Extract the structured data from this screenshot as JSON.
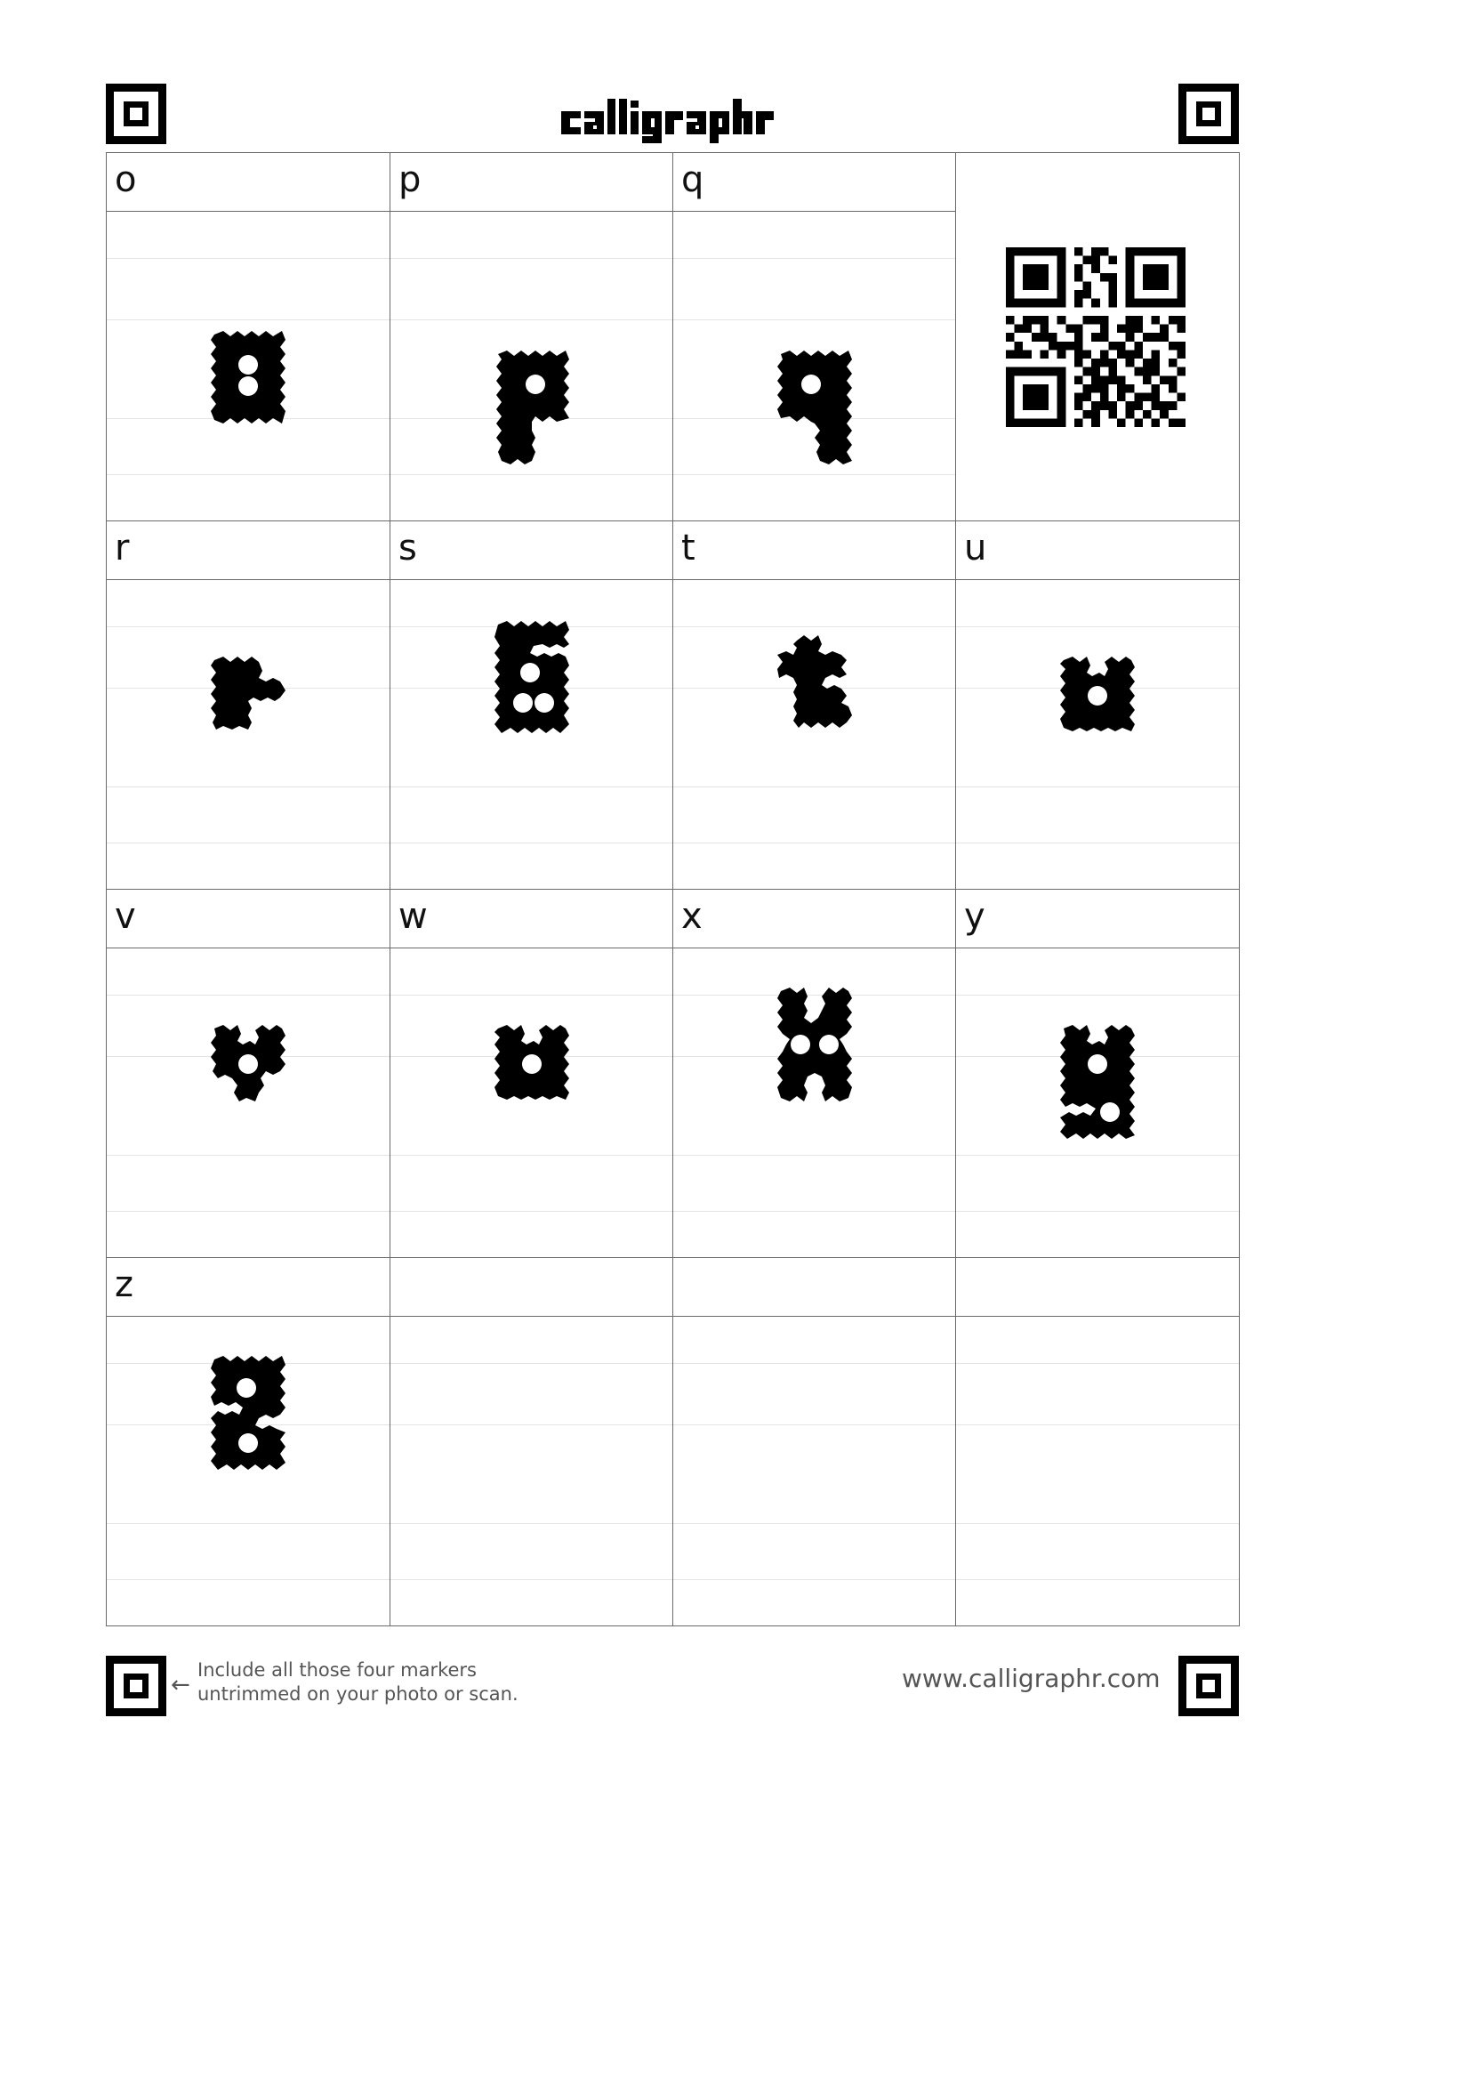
{
  "header": {
    "logo_text": "calligraphr"
  },
  "template": {
    "rows": [
      {
        "cells": [
          {
            "label": "o",
            "glyph": "o-glyph"
          },
          {
            "label": "p",
            "glyph": "p-glyph"
          },
          {
            "label": "q",
            "glyph": "q-glyph"
          }
        ]
      },
      {
        "cells": [
          {
            "label": "r",
            "glyph": "r-glyph"
          },
          {
            "label": "s",
            "glyph": "s-glyph"
          },
          {
            "label": "t",
            "glyph": "t-glyph"
          },
          {
            "label": "u",
            "glyph": "u-glyph"
          }
        ]
      },
      {
        "cells": [
          {
            "label": "v",
            "glyph": "v-glyph"
          },
          {
            "label": "w",
            "glyph": "w-glyph"
          },
          {
            "label": "x",
            "glyph": "x-glyph"
          },
          {
            "label": "y",
            "glyph": "y-glyph"
          }
        ]
      },
      {
        "cells": [
          {
            "label": "z",
            "glyph": "z-glyph"
          },
          {
            "label": ""
          },
          {
            "label": ""
          },
          {
            "label": ""
          }
        ]
      }
    ]
  },
  "qr_code": {
    "icon": "qr-code-icon"
  },
  "footer": {
    "arrow": "←",
    "note_line1": "Include all those four markers",
    "note_line2": "untrimmed on your photo or scan.",
    "url": "www.calligraphr.com"
  },
  "colors": {
    "ink": "#000000",
    "grid_line": "#6a6a6a",
    "guide_line": "#e4e4e4",
    "footer_text": "#555555"
  }
}
